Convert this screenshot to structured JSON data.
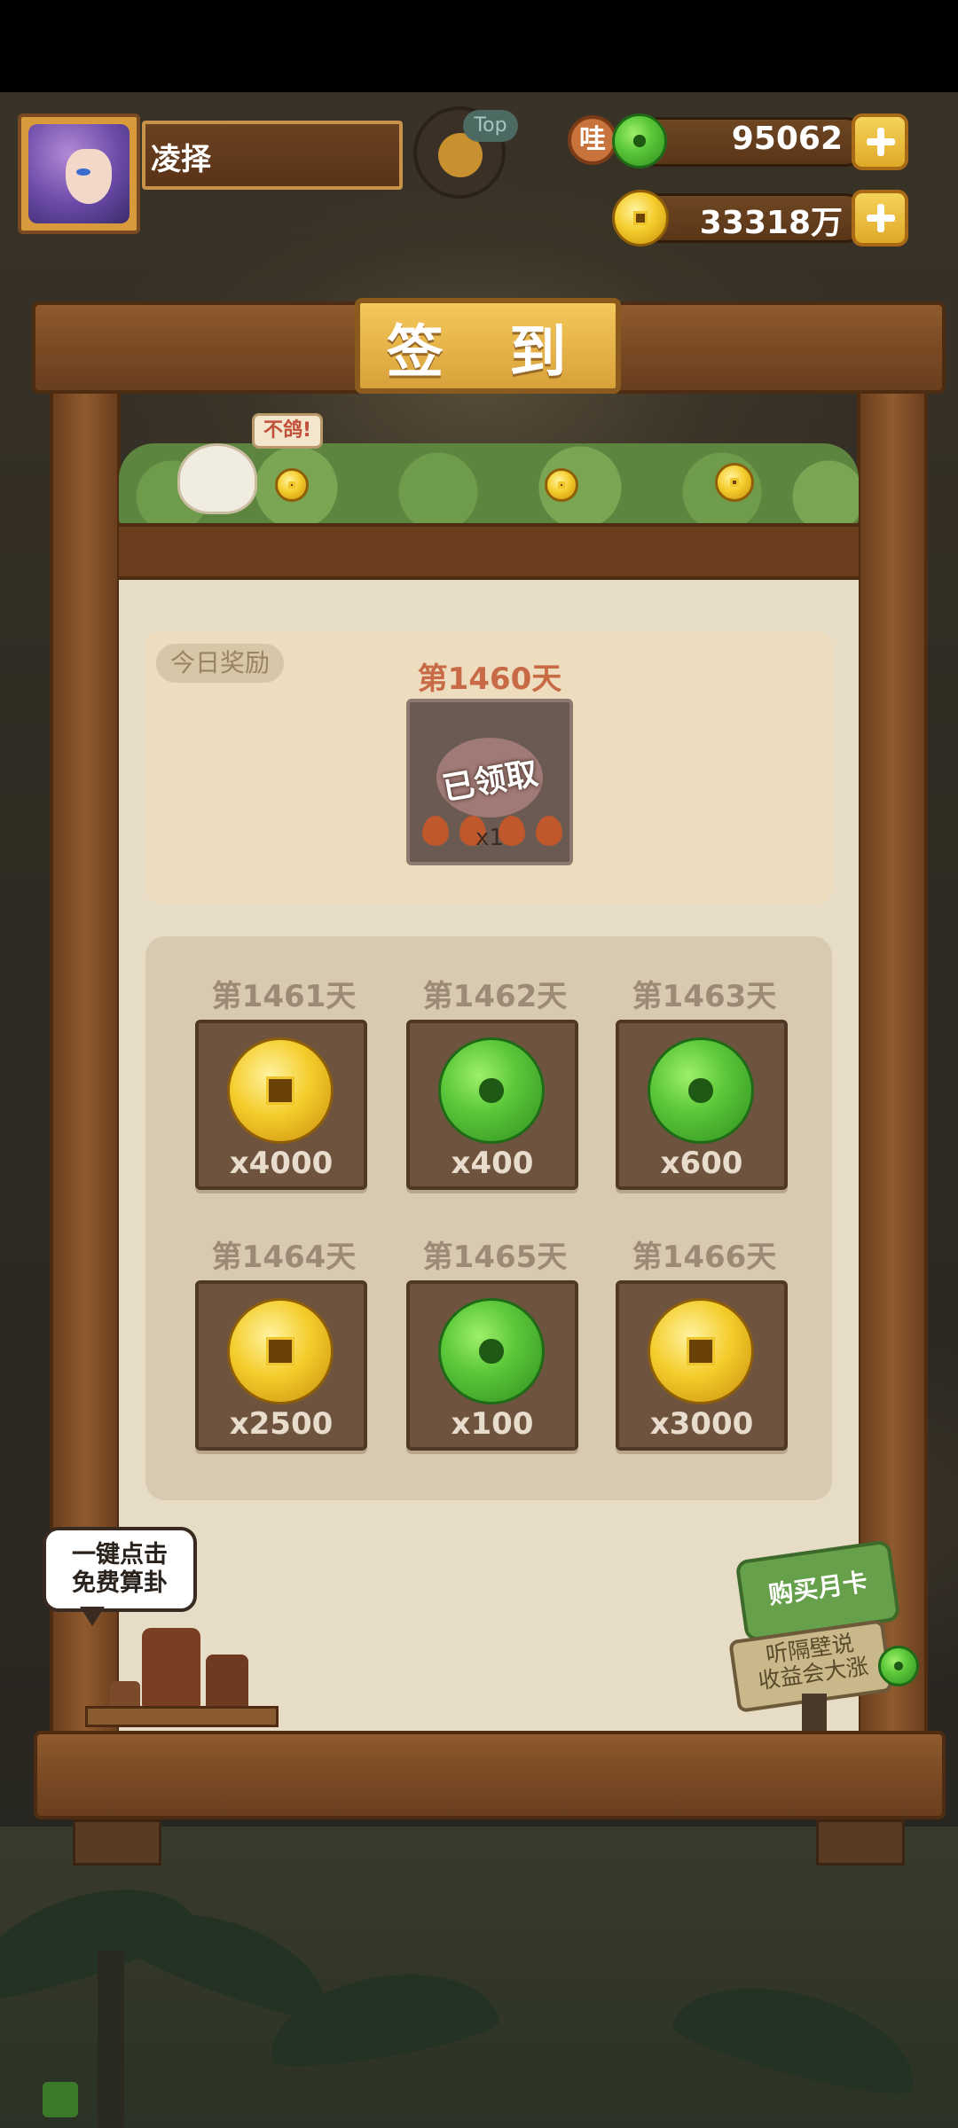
{
  "player": {
    "name": "凌择"
  },
  "top_badge": {
    "label": "Top"
  },
  "currency": {
    "jade": {
      "badge": "哇",
      "value": "95062"
    },
    "coins": {
      "value": "33318万"
    }
  },
  "dialog": {
    "title": "签 到",
    "mascot_speech": "不鸽!",
    "today_label": "今日奖励",
    "today": {
      "day": "第1460天",
      "status": "已领取",
      "qty": "x1"
    },
    "upcoming": [
      {
        "day": "第1461天",
        "reward": "coin",
        "qty": "x4000"
      },
      {
        "day": "第1462天",
        "reward": "jade",
        "qty": "x400"
      },
      {
        "day": "第1463天",
        "reward": "jade",
        "qty": "x600"
      },
      {
        "day": "第1464天",
        "reward": "coin",
        "qty": "x2500"
      },
      {
        "day": "第1465天",
        "reward": "jade",
        "qty": "x100"
      },
      {
        "day": "第1466天",
        "reward": "coin",
        "qty": "x3000"
      }
    ],
    "fortune_bubble": {
      "line1": "一键点击",
      "line2": "免费算卦"
    },
    "monthly_card": {
      "title": "购买月卡",
      "line1": "听隔壁说",
      "line2": "收益会大涨"
    }
  },
  "colors": {
    "gold": "#f4c85a",
    "wood": "#7a4a24",
    "panel": "#e7dcc6",
    "day_highlight": "#c86a46"
  }
}
